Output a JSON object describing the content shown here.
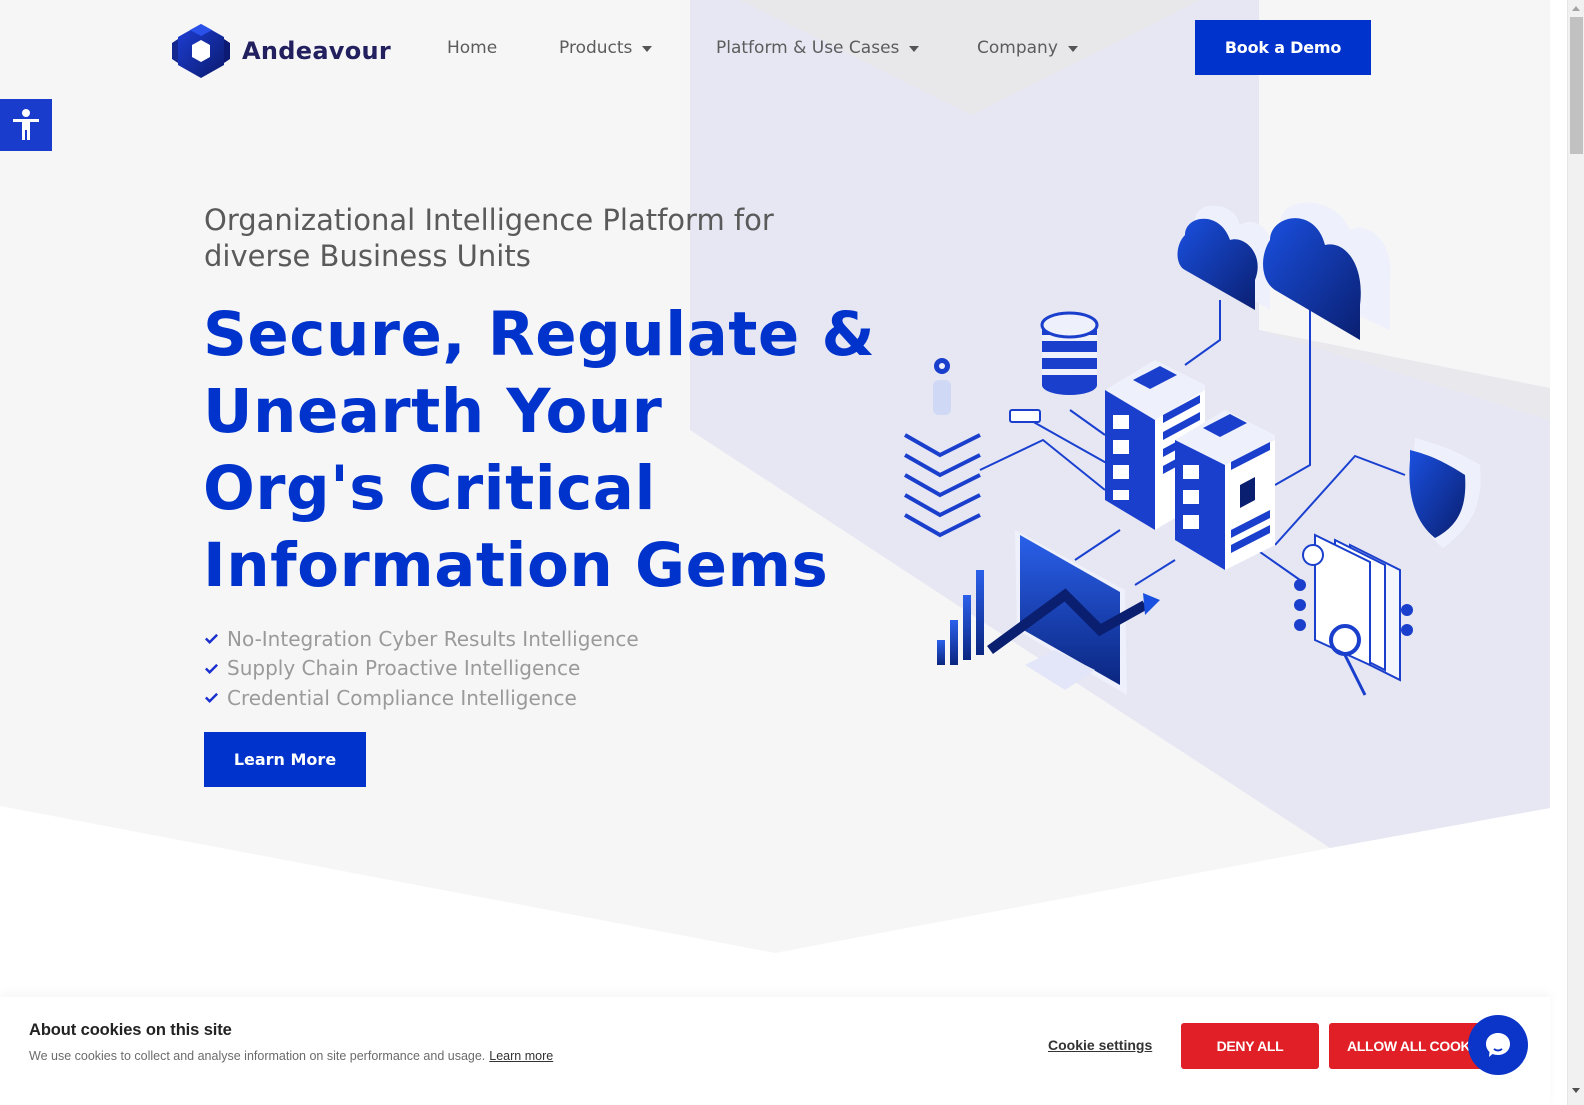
{
  "brand": {
    "name": "Andeavour",
    "primary_color": "#0033cc",
    "logo_dark_color": "#22205e",
    "cookie_button_color": "#e01f26"
  },
  "header": {
    "logo_icon": "hexagon-cube-logo-icon",
    "nav": [
      {
        "label": "Home",
        "has_dropdown": false
      },
      {
        "label": "Products",
        "has_dropdown": true
      },
      {
        "label": "Platform & Use Cases",
        "has_dropdown": true
      },
      {
        "label": "Company",
        "has_dropdown": true
      }
    ],
    "cta_label": "Book a Demo"
  },
  "accessibility": {
    "icon": "accessibility-person-icon"
  },
  "hero": {
    "subtitle": "Organizational Intelligence Platform for diverse Business Units",
    "title_lines": [
      "Secure, Regulate &",
      "Unearth Your",
      "Org's Critical",
      "Information Gems"
    ],
    "features": [
      "No-Integration Cyber Results Intelligence",
      "Supply Chain Proactive Intelligence",
      "Credential Compliance Intelligence"
    ],
    "feature_icon": "checkmark-icon",
    "cta_label": "Learn More",
    "illustration": "isometric-data-infrastructure-illustration"
  },
  "cookie_banner": {
    "title": "About cookies on this site",
    "description": "We use cookies to collect and analyse information on site performance and usage.",
    "learn_more": "Learn more",
    "settings_label": "Cookie settings",
    "deny_label": "DENY ALL",
    "allow_label": "ALLOW ALL COOKIES"
  },
  "chat_widget": {
    "icon": "chat-bubble-icon"
  }
}
